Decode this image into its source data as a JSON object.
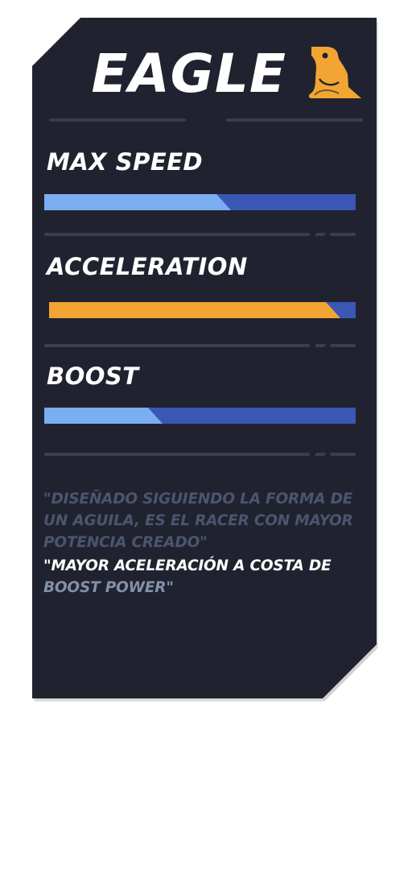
{
  "racer": {
    "name": "EAGLE",
    "icon": "eagle-icon",
    "accent_color": "#f2a533"
  },
  "stats": [
    {
      "label": "MAX SPEED",
      "value": 0.6,
      "fill_color": "#7aaef0",
      "track_color": "#3a57b5"
    },
    {
      "label": "ACCELERATION",
      "value": 0.95,
      "fill_color": "#f2a533",
      "track_color": "#3a57b5"
    },
    {
      "label": "BOOST",
      "value": 0.38,
      "fill_color": "#7aaef0",
      "track_color": "#3a57b5"
    }
  ],
  "description": {
    "line1": "\"DISEÑADO SIGUIENDO LA FORMA DE UN AGUILA, ES EL RACER CON MAYOR POTENCIA CREADO\"",
    "line2_highlight": "\"MAYOR ACELERACIÓN A COSTA DE",
    "line2_tail": "BOOST POWER\""
  }
}
